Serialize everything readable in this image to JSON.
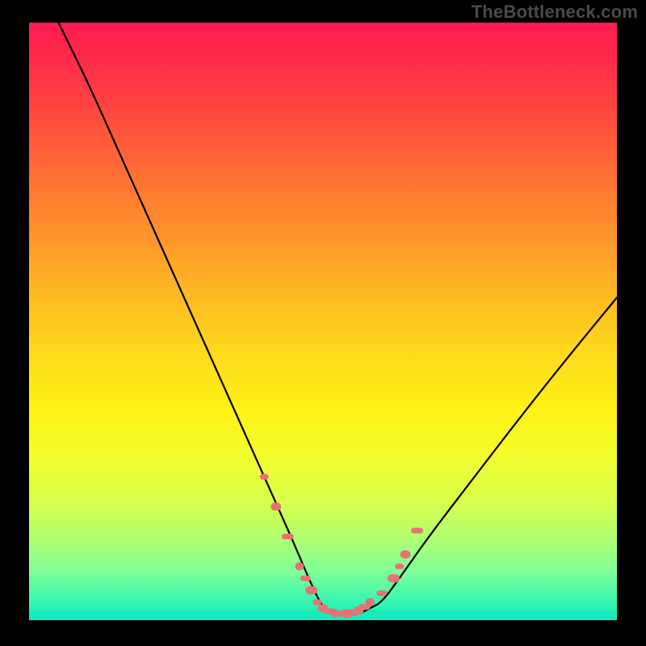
{
  "watermark": "TheBottleneck.com",
  "colors": {
    "frame_bg": "#000000",
    "curve_stroke": "#000000",
    "marker_fill": "#e57373",
    "gradient_top": "#ff1a52",
    "gradient_bottom": "#14eabb"
  },
  "chart_data": {
    "type": "line",
    "title": "",
    "xlabel": "",
    "ylabel": "",
    "xlim": [
      0,
      100
    ],
    "ylim": [
      0,
      100
    ],
    "grid": false,
    "legend": false,
    "series": [
      {
        "name": "bottleneck-curve",
        "x": [
          5,
          10,
          15,
          20,
          25,
          30,
          35,
          40,
          45,
          48,
          50,
          52,
          54,
          56,
          58,
          60,
          63,
          68,
          75,
          82,
          90,
          100
        ],
        "y": [
          100,
          90,
          79,
          68,
          57,
          46,
          35,
          24,
          13,
          6,
          2,
          1,
          1,
          1,
          2,
          3,
          7,
          14,
          23,
          32,
          42,
          54
        ]
      }
    ],
    "markers": {
      "name": "annotated-points",
      "x": [
        40,
        42,
        44,
        46,
        47,
        48,
        49,
        50,
        51,
        52,
        53,
        54,
        55,
        56,
        57,
        58,
        60,
        62,
        63,
        64,
        66
      ],
      "y": [
        24,
        19,
        14,
        9,
        7,
        5,
        3,
        2,
        1.5,
        1.2,
        1.1,
        1.1,
        1.3,
        1.6,
        2.2,
        3,
        4.5,
        7,
        9,
        11,
        15
      ]
    }
  }
}
